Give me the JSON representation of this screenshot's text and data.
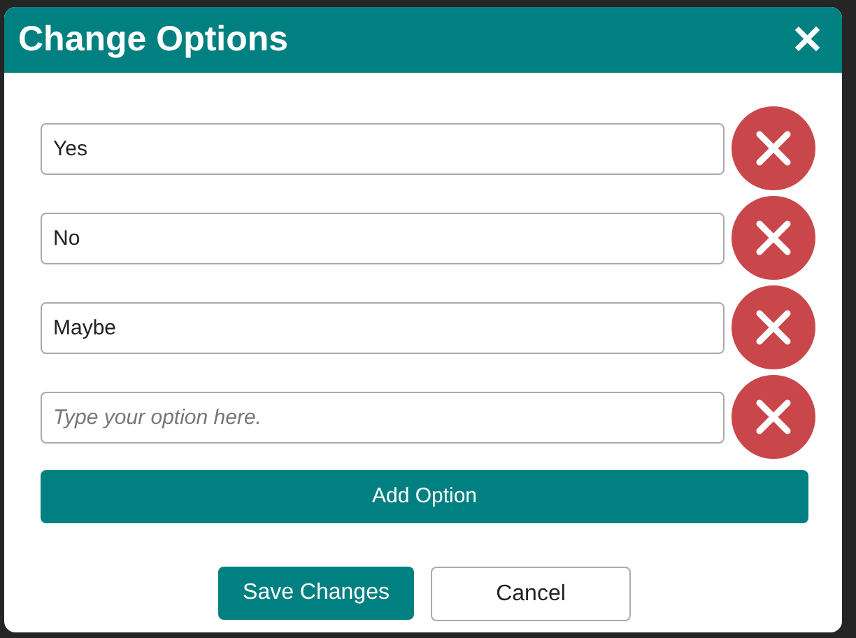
{
  "dialog": {
    "title": "Change Options",
    "close_label": "✕"
  },
  "options": [
    {
      "value": "Yes"
    },
    {
      "value": "No"
    },
    {
      "value": "Maybe"
    },
    {
      "placeholder": "Type your option here."
    }
  ],
  "add_button": "Add Option",
  "buttons": [
    {
      "label": "Save Changes",
      "kind": "primary"
    },
    {
      "label": "Cancel",
      "kind": "secondary"
    }
  ]
}
